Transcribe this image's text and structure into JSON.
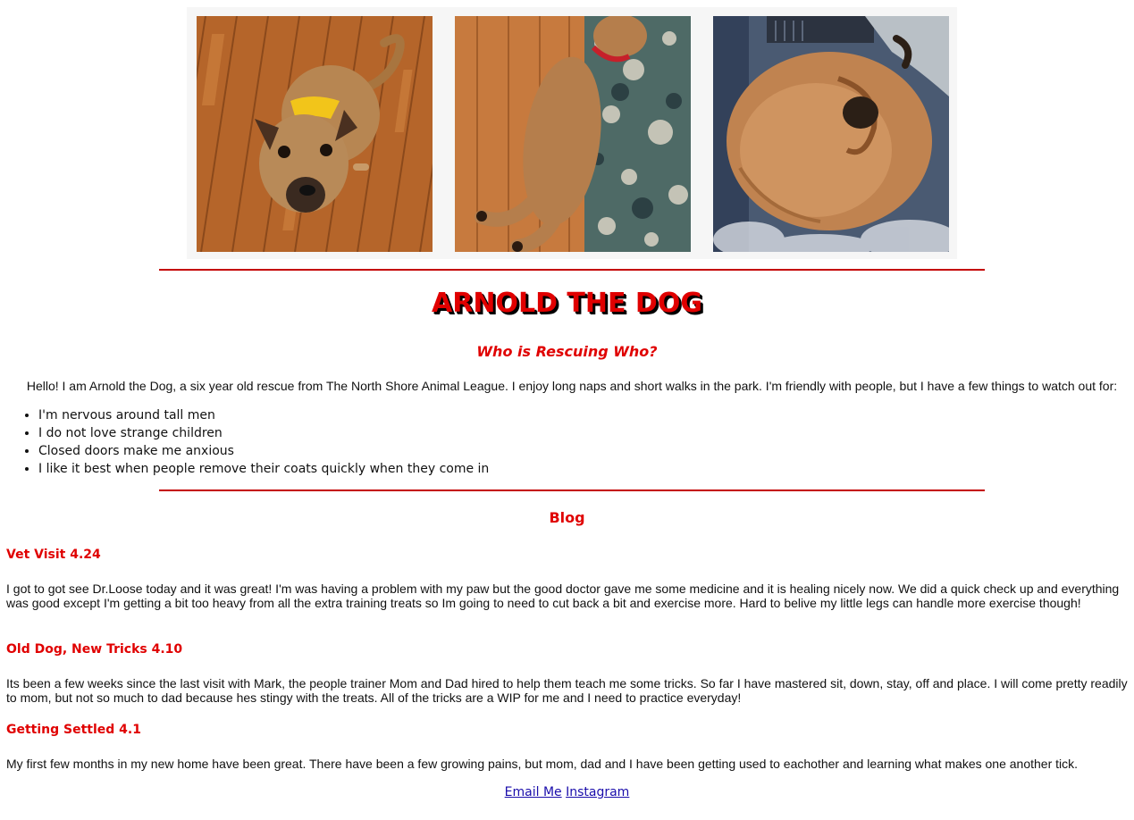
{
  "photos": [
    {
      "alt": "Arnold sitting on a wood floor looking up"
    },
    {
      "alt": "Arnold lying stretched out on a rug"
    },
    {
      "alt": "Arnold curled up asleep on a blanket"
    }
  ],
  "header": {
    "title": "ARNOLD THE DOG",
    "subtitle": "Who is Rescuing Who?"
  },
  "intro": {
    "text": "Hello! I am Arnold the Dog, a six year old rescue from The North Shore Animal League. I enjoy long naps and short walks in the park. I'm friendly with people, but I have a few things to watch out for:"
  },
  "traits": [
    "I'm nervous around tall men",
    "I do not love strange children",
    "Closed doors make me anxious",
    "I like it best when people remove their coats quickly when they come in"
  ],
  "blog": {
    "heading": "Blog",
    "posts": [
      {
        "title": "Vet Visit 4.24",
        "body": "I got to got see Dr.Loose today and it was great! I'm was having a problem with my paw but the good doctor gave me some medicine and it is healing nicely now. We did a quick check up and everything was good except I'm getting a bit too heavy from all the extra training treats so Im going to need to cut back a bit and exercise more. Hard to belive my little legs can handle more exercise though!"
      },
      {
        "title": "Old Dog, New Tricks 4.10",
        "body": "Its been a few weeks since the last visit with Mark, the people trainer Mom and Dad hired to help them teach me some tricks. So far I have mastered sit, down, stay, off and place. I will come pretty readily to mom, but not so much to dad because hes stingy with the treats. All of the tricks are a WIP for me and I need to practice everyday!"
      },
      {
        "title": "Getting Settled 4.1",
        "body": "My first few months in my new home have been great. There have been a few growing pains, but mom, dad and I have been getting used to eachother and learning what makes one another tick."
      }
    ]
  },
  "footer": {
    "email_label": "Email Me",
    "instagram_label": "Instagram"
  },
  "colors": {
    "accent_red": "#e00000",
    "rule_red": "#c40000",
    "link_blue": "#1a0dab"
  }
}
